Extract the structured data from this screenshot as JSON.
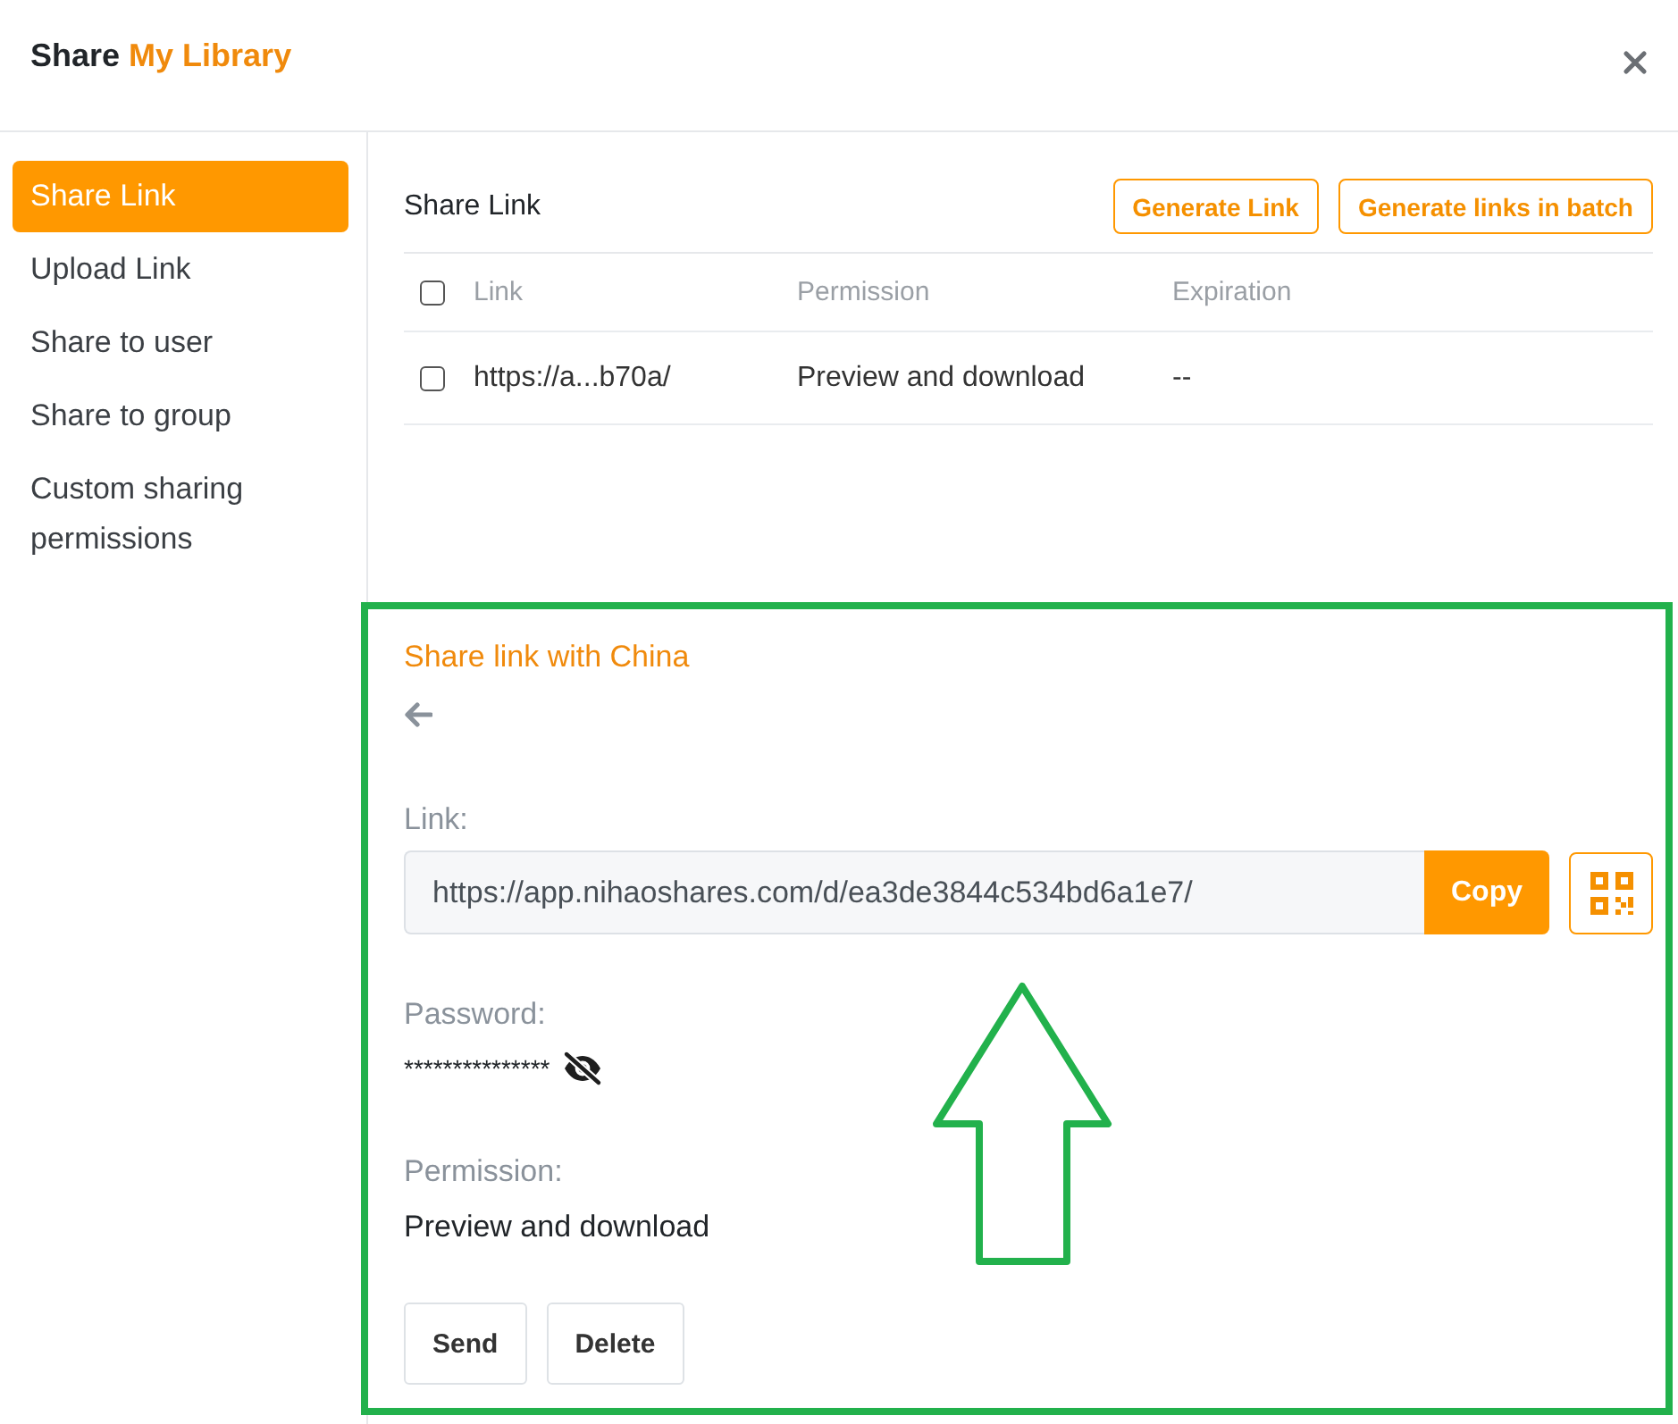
{
  "dialog": {
    "title": "Share",
    "library_name": "My Library"
  },
  "sidebar": {
    "items": [
      {
        "label": "Share Link",
        "selected": true
      },
      {
        "label": "Upload Link",
        "selected": false
      },
      {
        "label": "Share to user",
        "selected": false
      },
      {
        "label": "Share to group",
        "selected": false
      },
      {
        "label": "Custom sharing permissions",
        "selected": false
      }
    ]
  },
  "share_links": {
    "title": "Share Link",
    "buttons": [
      "Generate Link",
      "Generate links in batch"
    ],
    "table": {
      "header_checked": false,
      "columns": [
        "Link",
        "Permission",
        "Expiration"
      ],
      "rows": [
        {
          "checked": false,
          "cells": [
            "https://a...b70a/",
            "Preview and download",
            "--"
          ]
        }
      ]
    }
  },
  "link_detail": {
    "title": "Share link with China",
    "link_label": "Link:",
    "link_value": "https://app.nihaoshares.com/d/ea3de3844c534bd6a1e7/",
    "copy_button": "Copy",
    "password_label": "Password:",
    "password_value": "***************",
    "permission_label": "Permission:",
    "permission_value": "Preview and download",
    "buttons": [
      "Send",
      "Delete"
    ]
  }
}
